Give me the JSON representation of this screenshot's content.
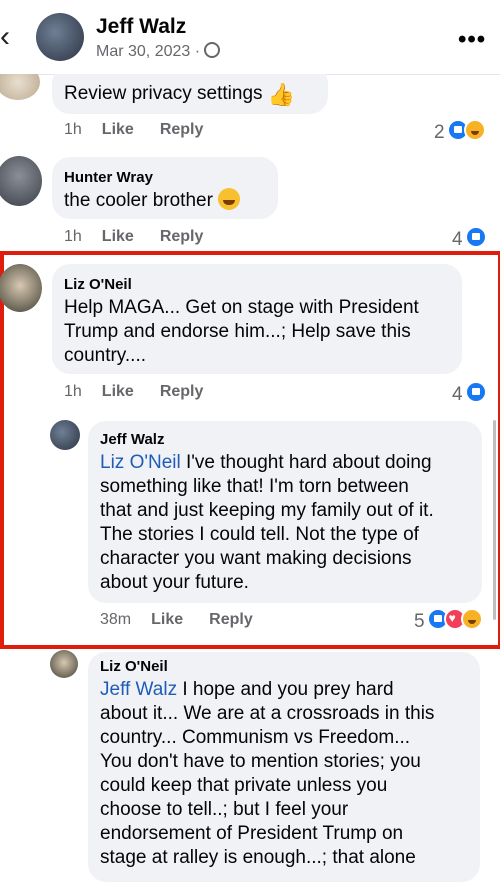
{
  "header": {
    "back_icon": "chevron-left-icon",
    "name": "Jeff Walz",
    "date": "Mar 30, 2023 ·",
    "more_icon": "more-icon"
  },
  "comments": [
    {
      "text": "Review privacy settings",
      "time": "1h",
      "like": "Like",
      "reply": "Reply",
      "reaction_count": "2"
    },
    {
      "author": "Hunter Wray",
      "text": "the cooler brother",
      "time": "1h",
      "like": "Like",
      "reply": "Reply",
      "reaction_count": "4"
    },
    {
      "author": "Liz O'Neil",
      "text_lines": [
        "Help MAGA... Get on stage with President",
        "Trump and endorse him...; Help save this",
        "country...."
      ],
      "time": "1h",
      "like": "Like",
      "reply": "Reply",
      "reaction_count": "4"
    },
    {
      "author": "Jeff Walz",
      "mention": "Liz O'Neil",
      "text_lines": [
        " I've thought hard about doing",
        "something like that! I'm torn between",
        "that and just keeping my family out of it.",
        "The stories I could tell. Not the type of",
        "character you want making decisions",
        "about your future."
      ],
      "time": "38m",
      "like": "Like",
      "reply": "Reply",
      "reaction_count": "5"
    },
    {
      "author": "Liz O'Neil",
      "mention": "Jeff Walz",
      "text_lines": [
        " I hope and you prey hard",
        "about it... We are at a crossroads in this",
        "country... Communism vs Freedom...",
        "You don't have to mention stories; you",
        "could keep that private unless you",
        "choose to tell..; but I feel your",
        "endorsement of President Trump on",
        "stage at ralley is enough...; that alone"
      ]
    }
  ],
  "colors": {
    "highlight_box": "#e01c0d",
    "mention": "#1f5cb8",
    "bubble": "#f0f2f5"
  }
}
